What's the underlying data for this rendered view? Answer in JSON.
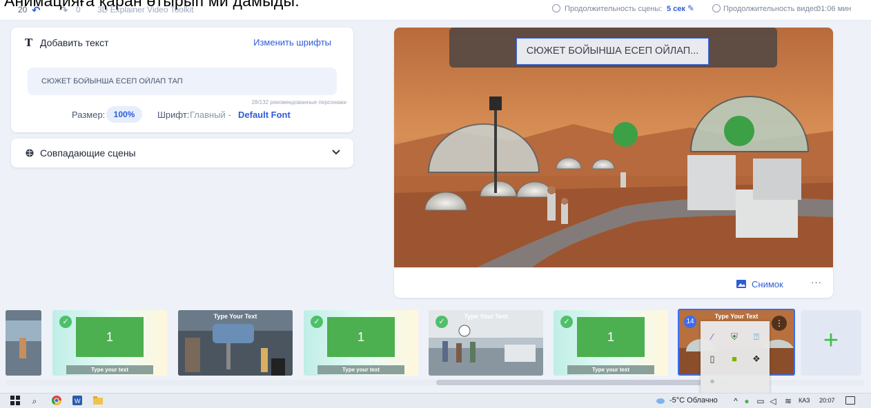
{
  "overlay_caption": "Анимацияға қаран өтырып ми дамыды.",
  "header": {
    "undo_count": "20",
    "redo_count": "0",
    "toolkit_name": "3D Explainer Video Toolkit",
    "scene_duration_label": "Продолжительность сцены:",
    "scene_duration_value": "5 сек",
    "video_duration_label": "Продолжительность видео:",
    "video_duration_value": "01:06 мин"
  },
  "text_panel": {
    "title": "Добавить текст",
    "change_fonts": "Изменить шрифты",
    "input_value": "СЮЖЕТ БОЙЫНША ЕСЕП ОЙЛАП ТАП",
    "counter": "28/132 рекомендованные персонажи",
    "size_label": "Размер:",
    "size_value": "100%",
    "font_label": "Шрифт:",
    "font_main": "Главный -",
    "font_value": "Default Font"
  },
  "matching_scenes": {
    "title": "Совпадающие сцены"
  },
  "preview": {
    "text": "СЮЖЕТ БОЙЫНША ЕСЕП ОЙЛАП...",
    "snapshot_label": "Снимок",
    "more_label": "···"
  },
  "timeline": {
    "thumbs": [
      {
        "type": "green",
        "number": "1",
        "caption": "Type your text"
      },
      {
        "type": "photo",
        "title": "Type Your Text"
      },
      {
        "type": "green",
        "number": "1",
        "caption": "Type your text"
      },
      {
        "type": "photo",
        "title": "Type Your Text"
      },
      {
        "type": "green",
        "number": "1",
        "caption": "Type your text"
      }
    ],
    "active_badge": "14",
    "active_title": "Type Your Text",
    "add_label": "+"
  },
  "taskbar": {
    "weather": "-5°C Облачно",
    "lang": "КАЗ",
    "time": "20:07"
  },
  "colors": {
    "accent": "#2e5bd8",
    "green": "#4cb050",
    "check": "#4fc06a",
    "plus": "#3fbf4e"
  }
}
